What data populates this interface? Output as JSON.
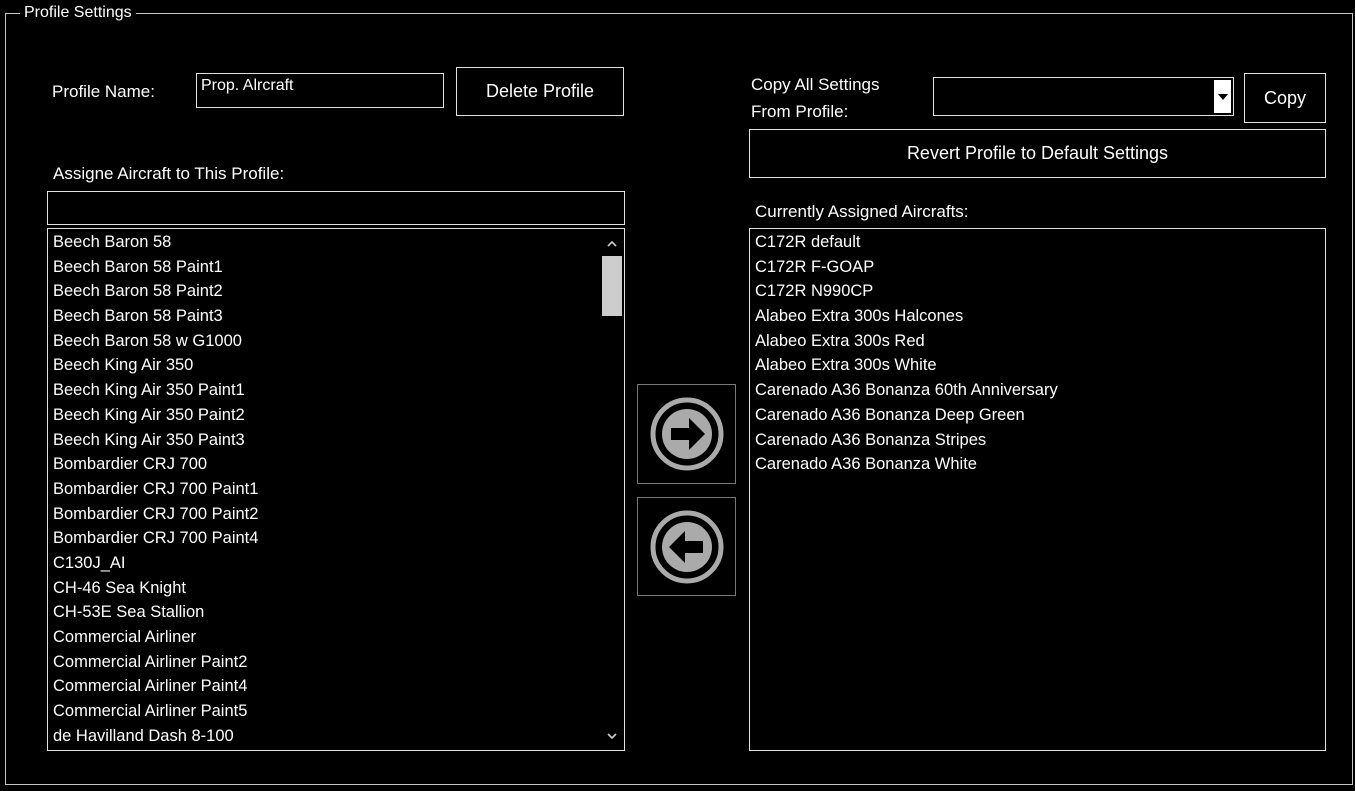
{
  "group": {
    "title": "Profile Settings"
  },
  "profile": {
    "name_label": "Profile Name:",
    "name_value": "Prop. Alrcraft",
    "delete_button": "Delete Profile"
  },
  "copy": {
    "label_line1": "Copy All Settings",
    "label_line2": "From Profile:",
    "dropdown_value": "",
    "copy_button": "Copy"
  },
  "revert_button": "Revert Profile to Default Settings",
  "assign": {
    "label": "Assigne Aircraft to This Profile:",
    "filter_value": "",
    "available": [
      "Beech Baron 58",
      "Beech Baron 58 Paint1",
      "Beech Baron 58 Paint2",
      "Beech Baron 58 Paint3",
      "Beech Baron 58 w G1000",
      "Beech King Air 350",
      "Beech King Air 350 Paint1",
      "Beech King Air 350 Paint2",
      "Beech King Air 350 Paint3",
      "Bombardier CRJ 700",
      "Bombardier CRJ 700 Paint1",
      "Bombardier CRJ 700 Paint2",
      "Bombardier CRJ 700 Paint4",
      "C130J_AI",
      "CH-46 Sea Knight",
      "CH-53E Sea Stallion",
      "Commercial Airliner",
      "Commercial Airliner Paint2",
      "Commercial Airliner Paint4",
      "Commercial Airliner Paint5",
      "de Havilland Dash 8-100"
    ]
  },
  "assigned": {
    "label": "Currently Assigned Aircrafts:",
    "items": [
      "C172R default",
      "C172R F-GOAP",
      "C172R N990CP",
      "Alabeo Extra 300s Halcones",
      "Alabeo Extra 300s Red",
      "Alabeo Extra 300s White",
      "Carenado A36 Bonanza 60th Anniversary",
      "Carenado A36 Bonanza Deep Green",
      "Carenado A36 Bonanza Stripes",
      "Carenado A36 Bonanza White"
    ]
  },
  "icons": {
    "add": "arrow-right-circle-icon",
    "remove": "arrow-left-circle-icon",
    "scroll_up": "chevron-up-icon",
    "scroll_down": "chevron-down-icon",
    "dropdown": "triangle-down-icon"
  }
}
